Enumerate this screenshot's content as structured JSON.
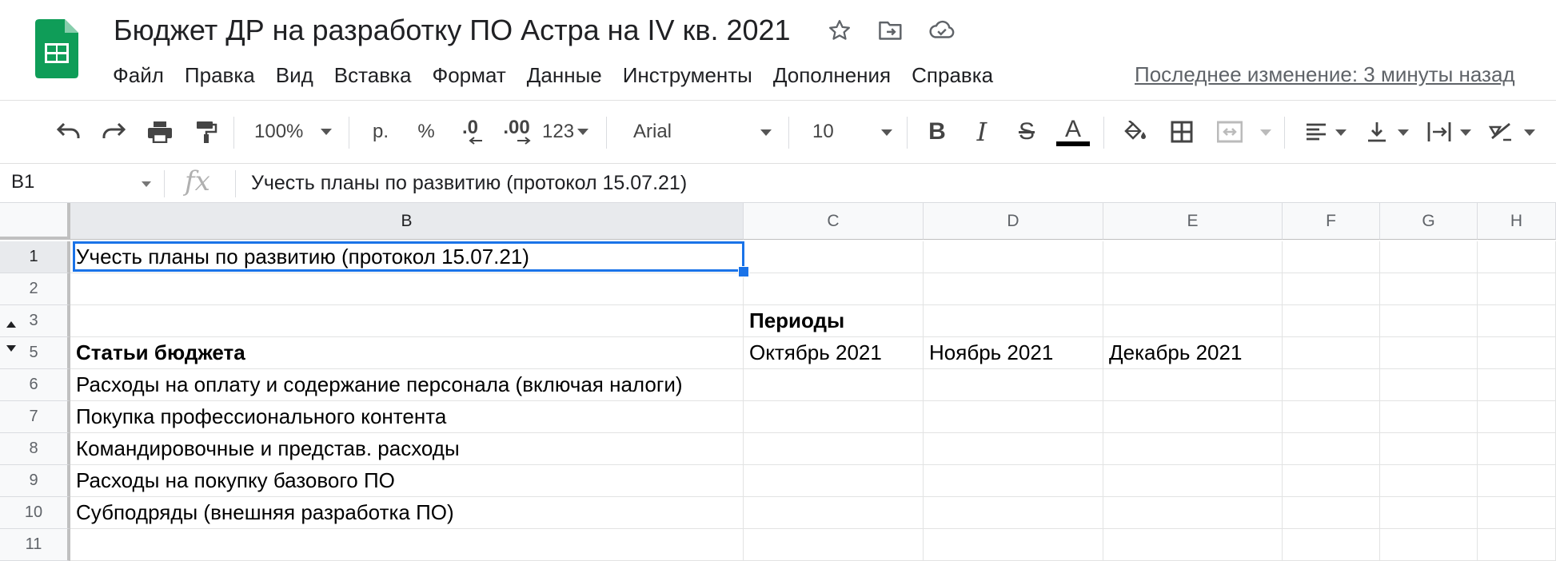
{
  "app": {
    "title": "Бюджет ДР на разработку ПО Астра на IV кв. 2021",
    "logo_icon": "sheets-logo-icon",
    "accent_color": "#1a73e8",
    "logo_color": "#0f9d58"
  },
  "menu": {
    "items": [
      "Файл",
      "Правка",
      "Вид",
      "Вставка",
      "Формат",
      "Данные",
      "Инструменты",
      "Дополнения",
      "Справка"
    ],
    "last_edit": "Последнее изменение: 3 минуты назад"
  },
  "toolbar": {
    "zoom": "100%",
    "currency": "р.",
    "percent": "%",
    "decrease_decimals": ".0",
    "increase_decimals": ".00",
    "more_formats": "123",
    "font": "Arial",
    "font_size": "10",
    "bold": "B",
    "italic": "I",
    "strikethrough": "S",
    "text_color": "A"
  },
  "formula_bar": {
    "name_box": "B1",
    "fx": "fx",
    "value": "Учесть планы по развитию (протокол 15.07.21)"
  },
  "grid": {
    "columns": [
      "B",
      "C",
      "D",
      "E",
      "F",
      "G",
      "H"
    ],
    "selected_column": "B",
    "rows": [
      {
        "num": "1",
        "cells": [
          "Учесть планы по развитию (протокол 15.07.21)",
          "",
          "",
          "",
          "",
          "",
          ""
        ]
      },
      {
        "num": "2",
        "cells": [
          "",
          "",
          "",
          "",
          "",
          "",
          ""
        ]
      },
      {
        "num": "3",
        "cells": [
          "",
          "Периоды",
          "",
          "",
          "",
          "",
          ""
        ]
      },
      {
        "num": "5",
        "cells": [
          "Статьи бюджета",
          "Октябрь 2021",
          "Ноябрь 2021",
          "Декабрь 2021",
          "",
          "",
          ""
        ]
      },
      {
        "num": "6",
        "cells": [
          "Расходы на оплату и содержание персонала (включая налоги)",
          "",
          "",
          "",
          "",
          "",
          ""
        ]
      },
      {
        "num": "7",
        "cells": [
          "Покупка профессионального контента",
          "",
          "",
          "",
          "",
          "",
          ""
        ]
      },
      {
        "num": "8",
        "cells": [
          "Командировочные и представ. расходы",
          "",
          "",
          "",
          "",
          "",
          ""
        ]
      },
      {
        "num": "9",
        "cells": [
          "Расходы на покупку базового ПО",
          "",
          "",
          "",
          "",
          "",
          ""
        ]
      },
      {
        "num": "10",
        "cells": [
          "Субподряды (внешняя разработка ПО)",
          "",
          "",
          "",
          "",
          "",
          ""
        ]
      },
      {
        "num": "11",
        "cells": [
          "",
          "",
          "",
          "",
          "",
          "",
          ""
        ]
      }
    ],
    "bold_cells": [
      [
        2,
        1
      ],
      [
        3,
        0
      ]
    ]
  }
}
